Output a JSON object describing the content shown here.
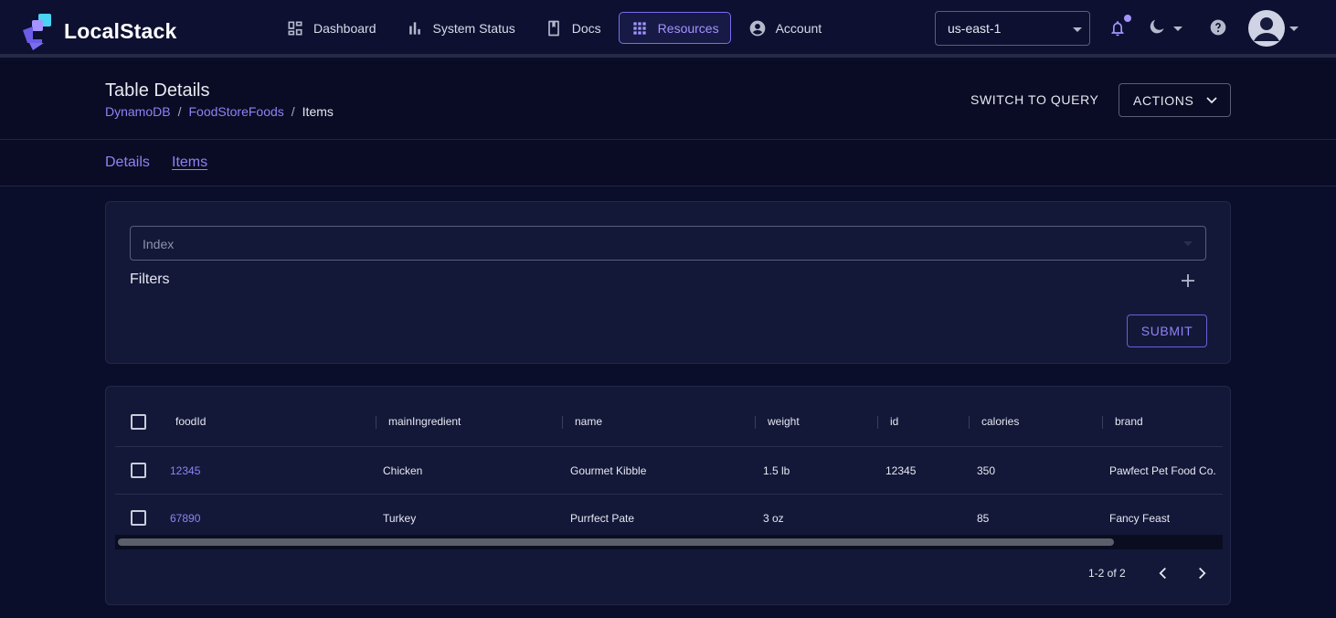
{
  "app": {
    "name": "LocalStack"
  },
  "nav": {
    "items": [
      {
        "label": "Dashboard",
        "icon": "dashboard-icon"
      },
      {
        "label": "System Status",
        "icon": "bar-chart-icon"
      },
      {
        "label": "Docs",
        "icon": "book-icon"
      },
      {
        "label": "Resources",
        "icon": "grid-icon",
        "active": true
      },
      {
        "label": "Account",
        "icon": "account-circle-icon"
      }
    ]
  },
  "region": {
    "value": "us-east-1"
  },
  "header": {
    "title": "Table Details",
    "breadcrumb": [
      "DynamoDB",
      "FoodStoreFoods",
      "Items"
    ],
    "switch_label": "SWITCH TO QUERY",
    "actions_label": "ACTIONS"
  },
  "tabs": [
    "Details",
    "Items"
  ],
  "filter": {
    "index_placeholder": "Index",
    "filters_label": "Filters",
    "submit_label": "SUBMIT"
  },
  "table": {
    "columns": [
      "foodId",
      "mainIngredient",
      "name",
      "weight",
      "id",
      "calories",
      "brand"
    ],
    "rows": [
      [
        "12345",
        "Chicken",
        "Gourmet Kibble",
        "1.5 lb",
        "12345",
        "350",
        "Pawfect Pet Food Co."
      ],
      [
        "67890",
        "Turkey",
        "Purrfect Pate",
        "3 oz",
        "",
        "85",
        "Fancy Feast"
      ]
    ],
    "pagination": "1-2 of 2"
  },
  "colors": {
    "accent": "#8f82f5",
    "background": "#0b0e2a",
    "card": "#131838"
  }
}
